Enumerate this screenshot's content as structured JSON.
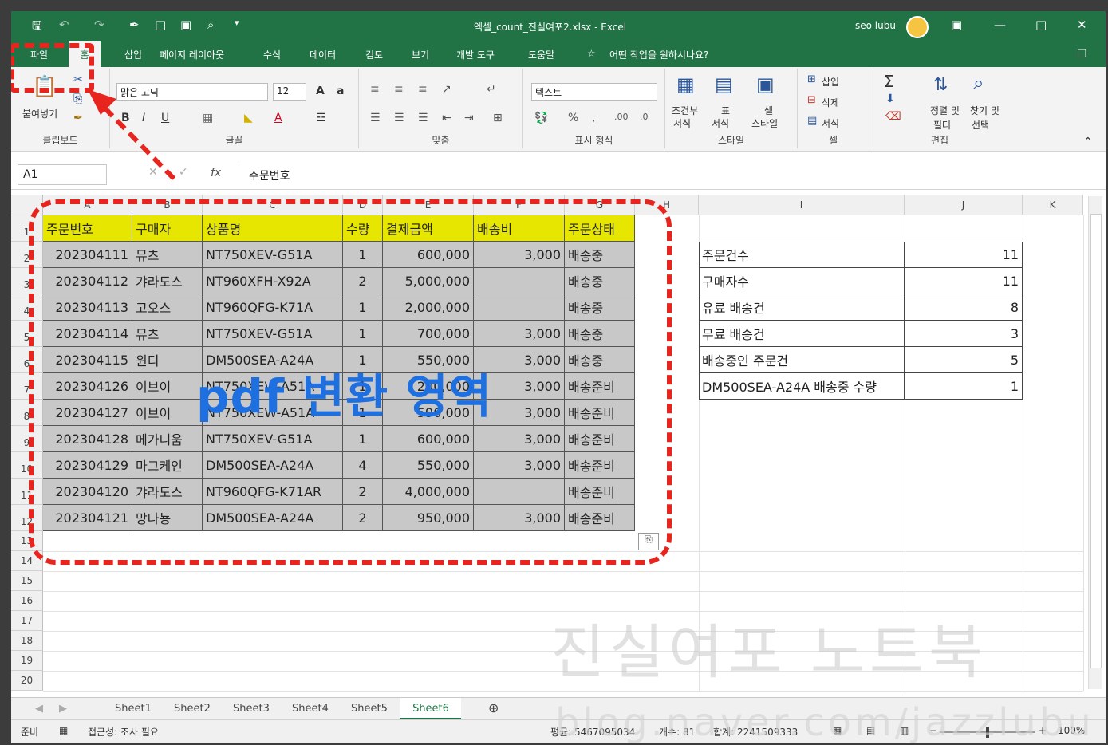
{
  "titlebar": {
    "title": "엑셀_count_진실여포2.xlsx  -  Excel",
    "user": "seo lubu"
  },
  "tabs": [
    "파일",
    "홈",
    "삽입",
    "페이지 레이아웃",
    "수식",
    "데이터",
    "검토",
    "보기",
    "개발 도구",
    "도움말"
  ],
  "tellme": "어떤 작업을 원하시나요?",
  "ribbon": {
    "clipboard": {
      "paste": "붙여넣기",
      "label": "클립보드"
    },
    "font": {
      "name": "맑은 고딕",
      "size": "12",
      "label": "글꼴"
    },
    "align": {
      "label": "맞춤"
    },
    "number": {
      "format": "텍스트",
      "label": "표시 형식"
    },
    "styles": {
      "cond": "조건부",
      "cond2": "서식",
      "table": "표",
      "table2": "서식",
      "cell": "셀",
      "cell2": "스타일",
      "label": "스타일"
    },
    "cells": {
      "insert": "삽입",
      "delete": "삭제",
      "format": "서식",
      "label": "셀"
    },
    "edit": {
      "sort": "정렬 및",
      "sort2": "필터",
      "find": "찾기 및",
      "find2": "선택",
      "label": "편집"
    }
  },
  "formula": {
    "namebox": "A1",
    "fx": "fx",
    "value": "주문번호"
  },
  "columns": [
    "A",
    "B",
    "C",
    "D",
    "E",
    "F",
    "G",
    "H",
    "I",
    "J",
    "K"
  ],
  "rows": [
    "1",
    "2",
    "3",
    "4",
    "5",
    "6",
    "7",
    "8",
    "9",
    "10",
    "11",
    "12",
    "13",
    "14",
    "15",
    "16",
    "17",
    "18",
    "19",
    "20"
  ],
  "table": {
    "headers": [
      "주문번호",
      "구매자",
      "상품명",
      "수량",
      "결제금액",
      "배송비",
      "주문상태"
    ],
    "rows": [
      [
        "202304111",
        "뮤츠",
        "NT750XEV-G51A",
        "1",
        "600,000",
        "3,000",
        "배송중"
      ],
      [
        "202304112",
        "갸라도스",
        "NT960XFH-X92A",
        "2",
        "5,000,000",
        "",
        "배송중"
      ],
      [
        "202304113",
        "고오스",
        "NT960QFG-K71A",
        "1",
        "2,000,000",
        "",
        "배송중"
      ],
      [
        "202304114",
        "뮤츠",
        "NT750XEV-G51A",
        "1",
        "700,000",
        "3,000",
        "배송중"
      ],
      [
        "202304115",
        "윈디",
        "DM500SEA-A24A",
        "1",
        "550,000",
        "3,000",
        "배송중"
      ],
      [
        "202304126",
        "이브이",
        "NT750XEW-A51A",
        "1",
        "200,000",
        "3,000",
        "배송준비"
      ],
      [
        "202304127",
        "이브이",
        "NT750XEW-A51A",
        "1",
        "590,000",
        "3,000",
        "배송준비"
      ],
      [
        "202304128",
        "메가니움",
        "NT750XEV-G51A",
        "1",
        "600,000",
        "3,000",
        "배송준비"
      ],
      [
        "202304129",
        "마그케인",
        "DM500SEA-A24A",
        "4",
        "550,000",
        "3,000",
        "배송준비"
      ],
      [
        "202304120",
        "갸라도스",
        "NT960QFG-K71AR",
        "2",
        "4,000,000",
        "",
        "배송준비"
      ],
      [
        "202304121",
        "망나뇽",
        "DM500SEA-A24A",
        "2",
        "950,000",
        "3,000",
        "배송준비"
      ]
    ]
  },
  "summary": [
    {
      "label": "주문건수",
      "value": "11"
    },
    {
      "label": "구매자수",
      "value": "11"
    },
    {
      "label": "유료 배송건",
      "value": "8"
    },
    {
      "label": "무료 배송건",
      "value": "3"
    },
    {
      "label": "배송중인 주문건",
      "value": "5"
    },
    {
      "label": "DM500SEA-A24A 배송중 수량",
      "value": "1"
    }
  ],
  "overlay": "pdf 변환 영역",
  "sheets": [
    "Sheet1",
    "Sheet2",
    "Sheet3",
    "Sheet4",
    "Sheet5",
    "Sheet6"
  ],
  "active_sheet": "Sheet6",
  "status": {
    "ready": "준비",
    "access": "접근성: 조사 필요",
    "avg": "평균: 5467095034",
    "count": "개수: 81",
    "sum": "합계: 2241509333",
    "zoom": "100%"
  },
  "watermark": {
    "line1": "진실여포 노트북",
    "line2": "blog.naver.com/jazzlubu"
  },
  "colors": {
    "excel_green": "#217346",
    "header_fill": "#e6e600",
    "body_fill": "#c8c8c8",
    "annotation_red": "#e8241f",
    "overlay_blue": "#1e6fe0"
  }
}
